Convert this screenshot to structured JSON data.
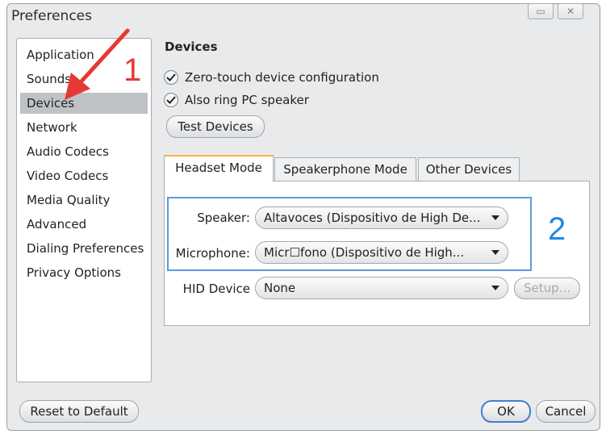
{
  "window": {
    "title": "Preferences",
    "minimize_icon": "minimize-icon",
    "close_icon": "close-icon"
  },
  "sidebar": {
    "items": [
      {
        "label": "Application"
      },
      {
        "label": "Sounds"
      },
      {
        "label": "Devices",
        "selected": true
      },
      {
        "label": "Network"
      },
      {
        "label": "Audio Codecs"
      },
      {
        "label": "Video Codecs"
      },
      {
        "label": "Media Quality"
      },
      {
        "label": "Advanced"
      },
      {
        "label": "Dialing Preferences"
      },
      {
        "label": "Privacy Options"
      }
    ]
  },
  "devices": {
    "section_title": "Devices",
    "zero_touch_label": "Zero-touch device configuration",
    "zero_touch_checked": true,
    "ring_pc_label": "Also ring PC speaker",
    "ring_pc_checked": true,
    "test_button": "Test Devices"
  },
  "tabs": [
    {
      "label": "Headset Mode",
      "active": true
    },
    {
      "label": "Speakerphone Mode"
    },
    {
      "label": "Other Devices"
    }
  ],
  "headset": {
    "speaker_label": "Speaker:",
    "speaker_value": "Altavoces (Dispositivo de High De...",
    "microphone_label": "Microphone:",
    "microphone_value": "Micr☐fono (Dispositivo de High...",
    "hid_label": "HID Device",
    "hid_value": "None",
    "setup_button": "Setup..."
  },
  "footer": {
    "reset_button": "Reset to Default",
    "ok_button": "OK",
    "cancel_button": "Cancel"
  },
  "annotations": {
    "step1": "1",
    "step2": "2",
    "arrow_color": "#e53935",
    "box_color": "#5a9bd8"
  }
}
